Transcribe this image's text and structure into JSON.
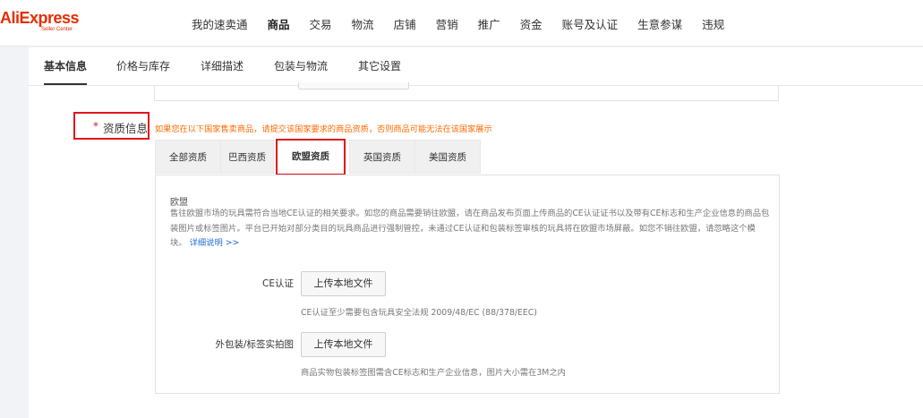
{
  "logo": {
    "brand": "AliExpress",
    "subtitle": "Seller Center"
  },
  "top_nav": [
    "我的速卖通",
    "商品",
    "交易",
    "物流",
    "店铺",
    "营销",
    "推广",
    "资金",
    "账号及认证",
    "生意参谋",
    "违规"
  ],
  "top_nav_active": "商品",
  "sub_tabs": [
    "基本信息",
    "价格与库存",
    "详细描述",
    "包装与物流",
    "其它设置"
  ],
  "sub_tab_active": "基本信息",
  "qualification": {
    "required_mark": "*",
    "label": "资质信息",
    "notice": "如果您在以下国家售卖商品，请提交该国家要求的商品资质，否则商品可能无法在该国家展示",
    "tabs": [
      "全部资质",
      "巴西资质",
      "欧盟资质",
      "英国资质",
      "美国资质"
    ],
    "active_tab": "欧盟资质",
    "region_title": "欧盟",
    "description": "售往欧盟市场的玩具需符合当地CE认证的相关要求。如您的商品需要销往欧盟，请在商品发布页面上传商品的CE认证证书以及带有CE标志和生产企业信息的商品包装图片或标签图片。平台已开始对部分类目的玩具商品进行强制管控，未通过CE认证和包装标签审核的玩具将在欧盟市场屏蔽。如您不销往欧盟，请忽略这个模块。",
    "description_link": "详细说明 >>",
    "fields": [
      {
        "label": "CE认证",
        "button": "上传本地文件",
        "hint": "CE认证至少需要包含玩具安全法规 2009/48/EC (88/378/EEC)"
      },
      {
        "label": "外包装/标签实拍图",
        "button": "上传本地文件",
        "hint": "商品实物包装标签图需含CE标志和生产企业信息，图片大小需在3M之内"
      }
    ]
  },
  "colors": {
    "brand": "#e62e04",
    "highlight_box": "#e0141e",
    "notice": "#ff6a00",
    "link": "#1f6ed4"
  }
}
